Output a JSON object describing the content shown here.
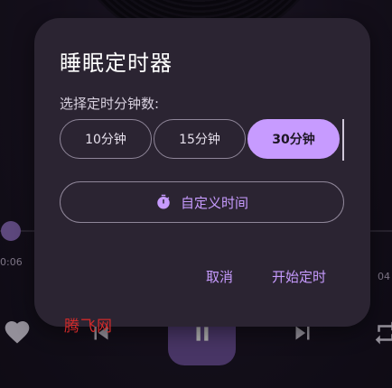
{
  "player": {
    "elapsed": "0:06",
    "remaining": "04",
    "progress_fraction": 0.03
  },
  "dialog": {
    "title": "睡眠定时器",
    "subtitle": "选择定时分钟数:",
    "options": [
      {
        "label": "10分钟",
        "selected": false
      },
      {
        "label": "15分钟",
        "selected": false
      },
      {
        "label": "30分钟",
        "selected": true
      }
    ],
    "custom_label": "自定义时间",
    "cancel_label": "取消",
    "start_label": "开始定时"
  },
  "watermark": "腾飞网",
  "colors": {
    "accent": "#c79bff",
    "dialog_bg": "#2b2432",
    "app_bg": "#1c1526",
    "outline": "#8f8699"
  },
  "icons": {
    "timer": "stopwatch-icon",
    "like": "heart-icon",
    "previous": "skip-previous-icon",
    "play_pause": "pause-icon",
    "next": "skip-next-icon",
    "repeat": "repeat-icon"
  }
}
